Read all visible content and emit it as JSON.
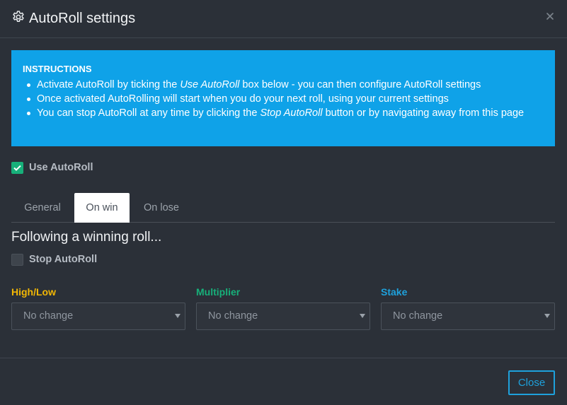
{
  "header": {
    "title": "AutoRoll settings",
    "icon": "gear-icon",
    "close_icon": "close-icon"
  },
  "instructions": {
    "title": "INSTRUCTIONS",
    "items": [
      {
        "before": "Activate AutoRoll by ticking the ",
        "em": "Use AutoRoll",
        "after": " box below - you can then configure AutoRoll settings"
      },
      {
        "before": "Once activated AutoRolling will start when you do your next roll, using your current settings",
        "em": "",
        "after": ""
      },
      {
        "before": "You can stop AutoRoll at any time by clicking the ",
        "em": "Stop AutoRoll",
        "after": " button or by navigating away from this page"
      }
    ]
  },
  "use_autoroll": {
    "label": "Use AutoRoll",
    "checked": true
  },
  "tabs": [
    {
      "label": "General",
      "active": false
    },
    {
      "label": "On win",
      "active": true
    },
    {
      "label": "On lose",
      "active": false
    }
  ],
  "panel": {
    "title": "Following a winning roll...",
    "stop_autoroll": {
      "label": "Stop AutoRoll",
      "checked": false
    },
    "fields": [
      {
        "label": "High/Low",
        "value": "No change",
        "color": "#f2b705"
      },
      {
        "label": "Multiplier",
        "value": "No change",
        "color": "#17b07a"
      },
      {
        "label": "Stake",
        "value": "No change",
        "color": "#1ea1dc"
      }
    ]
  },
  "footer": {
    "close_label": "Close"
  },
  "colors": {
    "background": "#2b3038",
    "instructions_bg": "#0fa2e8",
    "checkbox_on": "#17b07a",
    "accent": "#1ea1dc"
  }
}
